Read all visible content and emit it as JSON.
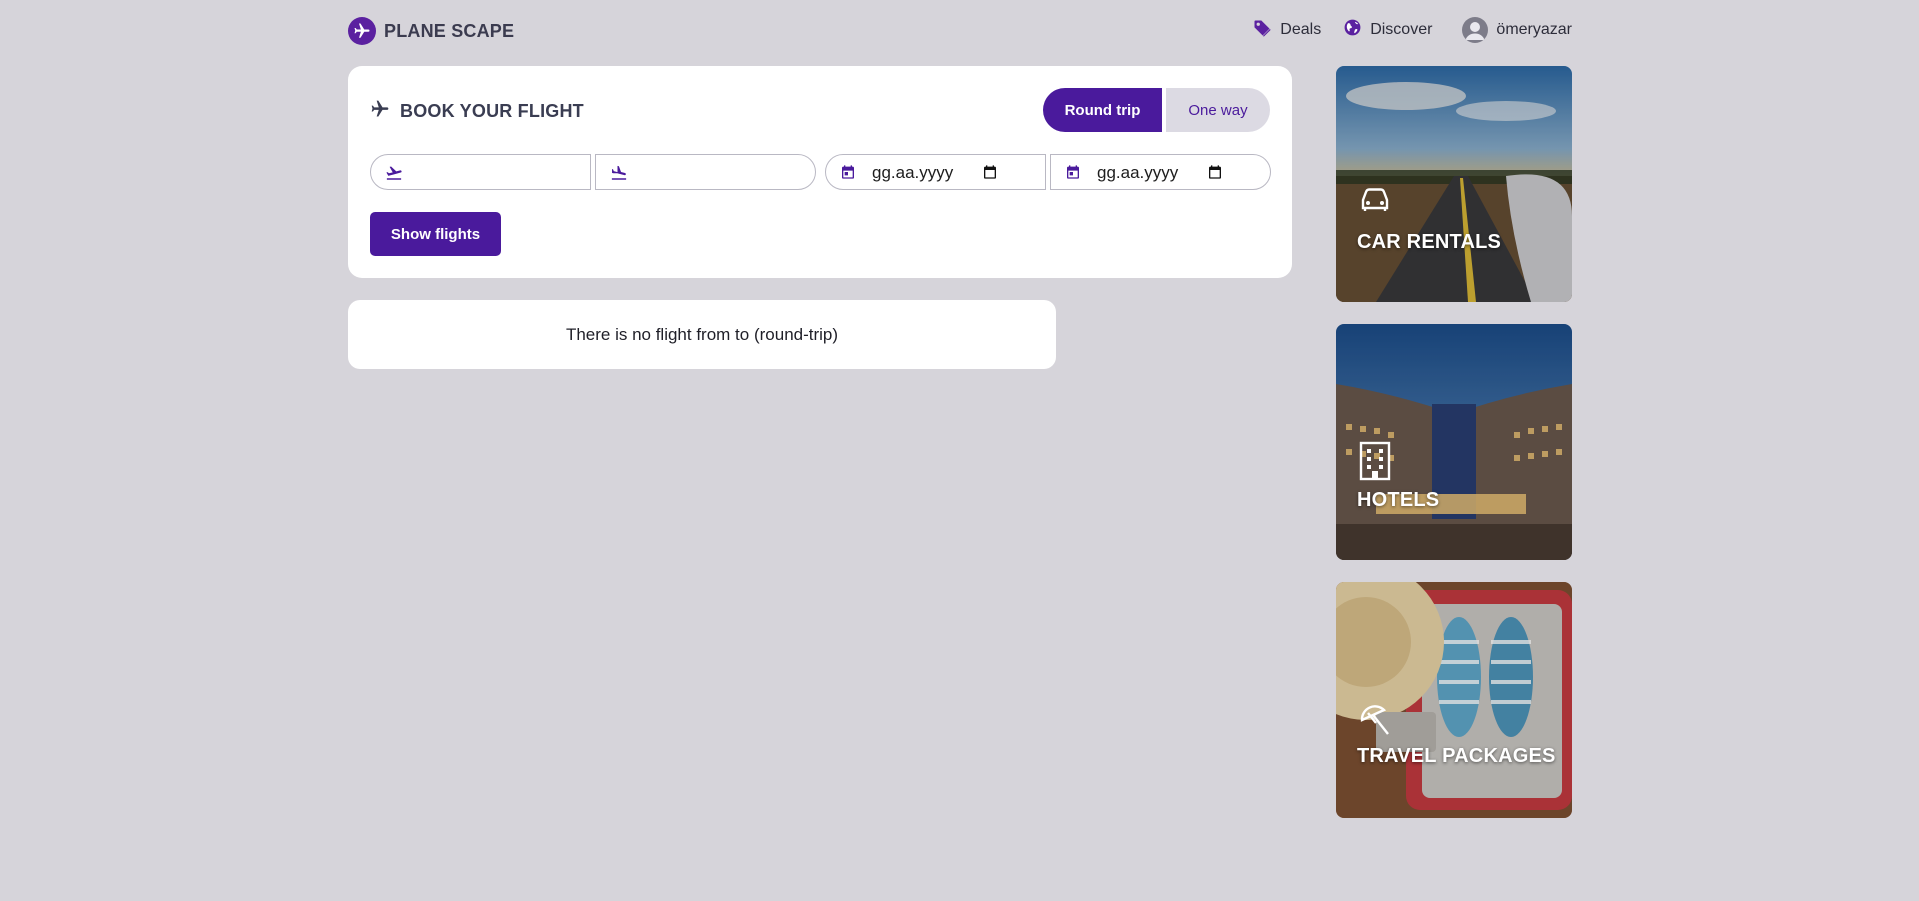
{
  "header": {
    "brand": "PLANE SCAPE",
    "nav": {
      "deals": "Deals",
      "discover": "Discover",
      "user": "ömeryazar"
    }
  },
  "booking": {
    "title": "BOOK YOUR FLIGHT",
    "trip_type": {
      "round_trip": "Round trip",
      "one_way": "One way",
      "selected": "Round trip"
    },
    "from": {
      "value": ""
    },
    "to": {
      "value": ""
    },
    "departure_date": {
      "placeholder": "gg.aa.yyyy"
    },
    "return_date": {
      "placeholder": "gg.aa.yyyy"
    },
    "submit_label": "Show flights"
  },
  "result": {
    "message": "There is no flight from to (round-trip)"
  },
  "promos": {
    "car": {
      "label": "CAR RENTALS",
      "icon": "car-icon"
    },
    "hotel": {
      "label": "HOTELS",
      "icon": "building-icon"
    },
    "travel": {
      "label": "TRAVEL PACKAGES",
      "icon": "beach-umbrella-icon"
    }
  },
  "colors": {
    "page_bg": "#d6d4da",
    "brand_purple": "#4a1a9c",
    "logo_purple": "#5b21a0",
    "toggle_inactive_bg": "#dcdae3"
  }
}
